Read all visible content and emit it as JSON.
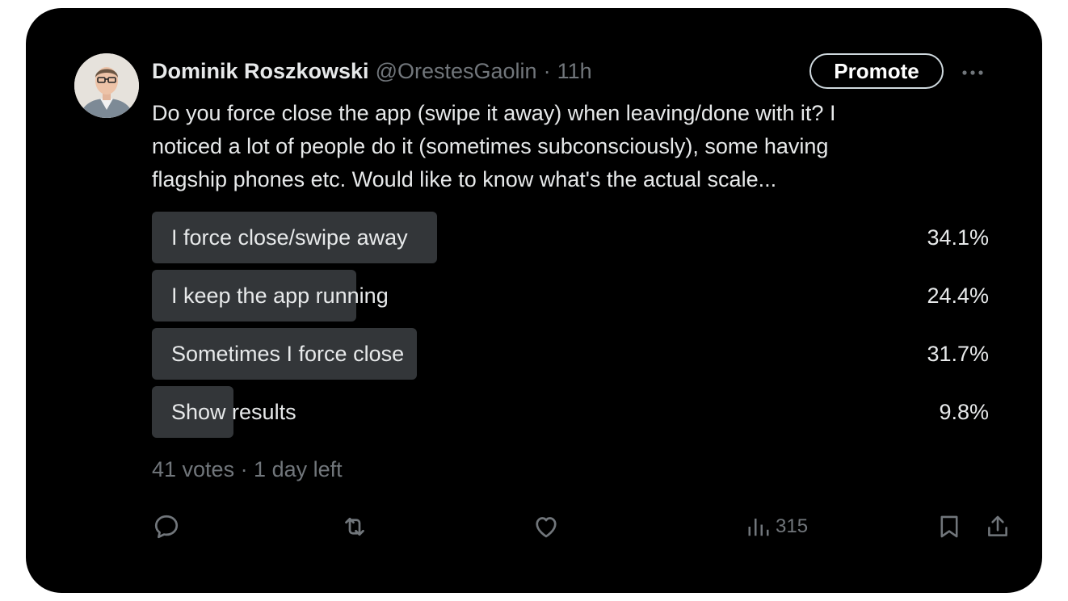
{
  "author": {
    "name": "Dominik Roszkowski",
    "handle": "@OrestesGaolin",
    "separator": "·",
    "time": "11h"
  },
  "header": {
    "promote_label": "Promote",
    "more_icon": "more-horizontal-icon"
  },
  "tweet": {
    "line1": "Do you force close the app (swipe it away) when leaving/done with it? I",
    "line2": "noticed a lot of people do it (sometimes subconsciously), some having",
    "line3": "flagship phones etc. Would like to know what's the actual scale..."
  },
  "poll": {
    "options": [
      {
        "label": "I force close/swipe away",
        "percent_text": "34.1%",
        "percent": 34.1
      },
      {
        "label": "I keep the app running",
        "percent_text": "24.4%",
        "percent": 24.4
      },
      {
        "label": "Sometimes I force close",
        "percent_text": "31.7%",
        "percent": 31.7
      },
      {
        "label": "Show results",
        "percent_text": "9.8%",
        "percent": 9.8
      }
    ],
    "meta": "41 votes · 1 day left"
  },
  "actions": {
    "reply_icon": "reply-icon",
    "retweet_icon": "retweet-icon",
    "like_icon": "heart-icon",
    "views_icon": "views-icon",
    "views_count": "315",
    "bookmark_icon": "bookmark-icon",
    "share_icon": "share-icon"
  },
  "colors": {
    "background": "#000000",
    "text": "#e7e9ea",
    "muted": "#71767b",
    "poll_bar": "#333639"
  }
}
